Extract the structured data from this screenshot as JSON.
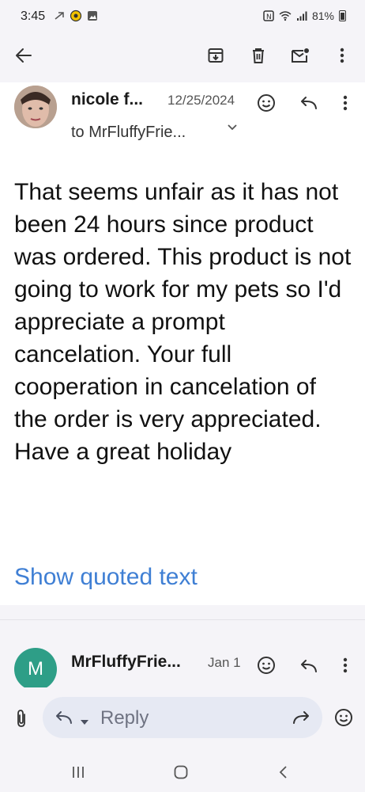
{
  "status_bar": {
    "time": "3:45",
    "battery": "81%"
  },
  "toolbar": {
    "back": "arrow-back-icon",
    "archive": "archive-icon",
    "delete": "trash-icon",
    "mark_unread": "mark-unread-icon",
    "more": "more-vert-icon"
  },
  "message": {
    "sender": "nicole f...",
    "date": "12/25/2024",
    "recipient": "to MrFluffyFrie...",
    "body": "That seems unfair as it has not been 24 hours since product was ordered.  This product is not going to work for my pets so I'd appreciate a prompt cancelation. Your full cooperation in cancelation of the order is very appreciated.  Have a great holiday",
    "show_quoted": "Show quoted text"
  },
  "message2": {
    "avatar_letter": "M",
    "sender": "MrFluffyFrie...",
    "date": "Jan 1"
  },
  "reply_bar": {
    "placeholder": "Reply"
  },
  "colors": {
    "link": "#3f7fd4",
    "avatar_m": "#2e9e87",
    "background": "#f5f4f8"
  }
}
